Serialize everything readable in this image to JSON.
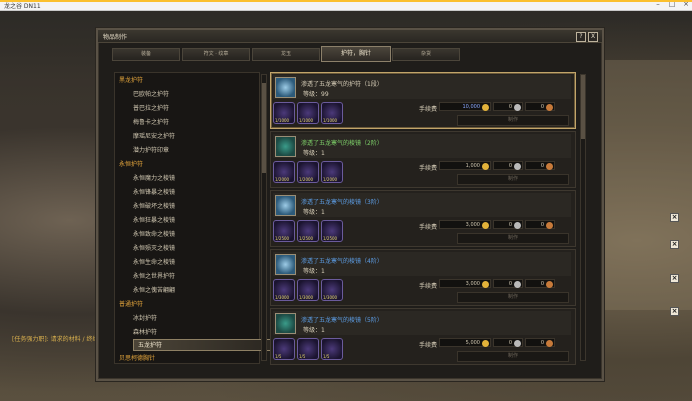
{
  "app_title": "龙之谷 DN11",
  "window": {
    "title": "物品制作",
    "help": "?",
    "close": "X"
  },
  "tabs": [
    "装备",
    "符文 · 纹章",
    "龙玉",
    "护符，胸针",
    "杂货"
  ],
  "active_tab": 3,
  "categories": [
    {
      "label": "黑龙护符",
      "items": [
        "巴欧帕之护符",
        "普巴拉之护符",
        "梅鲁卡之护符",
        "摩瑶尼安之护符",
        "潜力护符印章"
      ]
    },
    {
      "label": "永恒护符",
      "items": [
        "永恒魔力之棱镜",
        "永恒锋暴之棱镜",
        "永恒破坏之棱镜",
        "永恒狂暴之棱镜",
        "永恒致命之棱镜",
        "永恒殒灭之棱镜",
        "永恒生命之棱镜",
        "永恒之世界护符",
        "永恒之傀苦翩翩"
      ]
    },
    {
      "label": "普通护符",
      "items": [
        "冰封护符",
        "森林护符",
        "五龙护符"
      ]
    },
    {
      "label": "贝思柯德胸针",
      "items": []
    }
  ],
  "selected_item": "五龙护符",
  "recipes": [
    {
      "name": "渗透了五龙寒气的护符（1段）",
      "level_label": "等级：99",
      "fee": "10,000",
      "silver": "0",
      "copper": "0",
      "mats": [
        "1/1000",
        "1/1000",
        "1/1000"
      ],
      "make": "制作"
    },
    {
      "name": "渗透了五龙寒气的棱镜（2阶）",
      "level_label": "等级：1",
      "fee": "1,000",
      "silver": "0",
      "copper": "0",
      "mats": [
        "1/2000",
        "1/2000",
        "1/2000"
      ],
      "make": "制作"
    },
    {
      "name": "渗透了五龙寒气的棱镜（3阶）",
      "level_label": "等级：1",
      "fee": "3,000",
      "silver": "0",
      "copper": "0",
      "mats": [
        "1/2500",
        "1/2500",
        "1/2500"
      ],
      "make": "制作"
    },
    {
      "name": "渗透了五龙寒气的棱镜（4阶）",
      "level_label": "等级：1",
      "fee": "3,000",
      "silver": "0",
      "copper": "0",
      "mats": [
        "1/3000",
        "1/3000",
        "1/3000"
      ],
      "make": "制作"
    },
    {
      "name": "渗透了五龙寒气的棱镜（5阶）",
      "level_label": "等级：1",
      "fee": "5,000",
      "silver": "0",
      "copper": "0",
      "mats": [
        "1/5",
        "1/5",
        "1/5"
      ],
      "make": "制作"
    }
  ],
  "fee_label": "手续费",
  "bottom_text": "[任务强力职]: 请求的材料 / 终结",
  "colors": {
    "category": "#e3a53c",
    "gold": "#e2b23a",
    "selected_border": "#c2a56a"
  }
}
